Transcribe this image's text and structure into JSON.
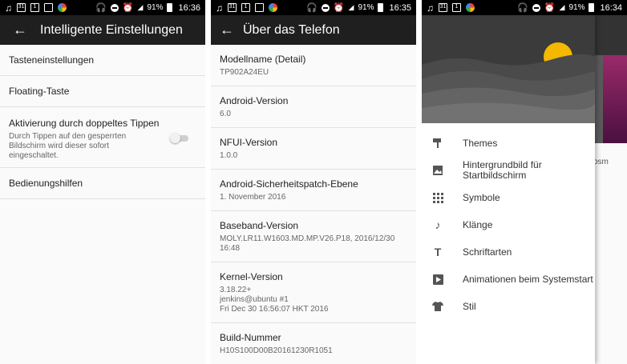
{
  "statusbar": [
    {
      "battery": "91%",
      "time": "16:36"
    },
    {
      "battery": "91%",
      "time": "16:35"
    },
    {
      "battery": "91%",
      "time": "16:34"
    }
  ],
  "panel1": {
    "title": "Intelligente Einstellungen",
    "items": [
      {
        "title": "Tasteneinstellungen"
      },
      {
        "title": "Floating-Taste"
      },
      {
        "title": "Aktivierung durch doppeltes Tippen",
        "subtitle_lines": [
          "Durch Tippen auf den gesperrten",
          "Bildschirm wird dieser sofort",
          "eingeschaltet."
        ],
        "toggle_on": false
      },
      {
        "title": "Bedienungshilfen"
      }
    ]
  },
  "panel2": {
    "title": "Über das Telefon",
    "items": [
      {
        "title": "Modellname (Detail)",
        "lines": [
          "TP902A24EU"
        ]
      },
      {
        "title": "Android-Version",
        "lines": [
          "6.0"
        ]
      },
      {
        "title": "NFUI-Version",
        "lines": [
          "1.0.0"
        ]
      },
      {
        "title": "Android-Sicherheitspatch-Ebene",
        "lines": [
          "1. November 2016"
        ]
      },
      {
        "title": "Baseband-Version",
        "lines": [
          "MOLY.LR11.W1603.MD.MP.V26.P18, 2016/12/30",
          "16:48"
        ]
      },
      {
        "title": "Kernel-Version",
        "lines": [
          "3.18.22+",
          "jenkins@ubuntu #1",
          "Fri Dec 30 16:56:07 HKT 2016"
        ]
      },
      {
        "title": "Build-Nummer",
        "lines": [
          "H10S100D00B20161230R1051"
        ]
      }
    ]
  },
  "panel3": {
    "background_text": "osm",
    "menu": [
      {
        "icon": "paint-roller-icon",
        "label_lines": [
          "Themes"
        ]
      },
      {
        "icon": "image-icon",
        "label_lines": [
          "Hintergrundbild für",
          "Startbildschirm"
        ]
      },
      {
        "icon": "apps-grid-icon",
        "label_lines": [
          "Symbole"
        ]
      },
      {
        "icon": "music-note-icon",
        "label_lines": [
          "Klänge"
        ]
      },
      {
        "icon": "text-t-icon",
        "label_lines": [
          "Schriftarten"
        ]
      },
      {
        "icon": "animation-icon",
        "label_lines": [
          "Animationen beim Systemstart"
        ]
      },
      {
        "icon": "tshirt-icon",
        "label_lines": [
          "Stil"
        ]
      }
    ]
  },
  "colors": {
    "appbar": "#1f1f1f",
    "statusbar": "#000000",
    "sun": "#f5b800",
    "accent_purple": "#9a2a6a"
  }
}
